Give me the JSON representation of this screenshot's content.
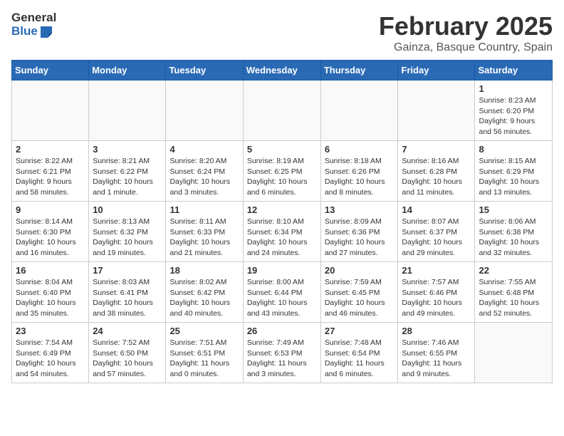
{
  "logo": {
    "general": "General",
    "blue": "Blue"
  },
  "title": "February 2025",
  "subtitle": "Gainza, Basque Country, Spain",
  "weekdays": [
    "Sunday",
    "Monday",
    "Tuesday",
    "Wednesday",
    "Thursday",
    "Friday",
    "Saturday"
  ],
  "weeks": [
    [
      {
        "day": "",
        "info": ""
      },
      {
        "day": "",
        "info": ""
      },
      {
        "day": "",
        "info": ""
      },
      {
        "day": "",
        "info": ""
      },
      {
        "day": "",
        "info": ""
      },
      {
        "day": "",
        "info": ""
      },
      {
        "day": "1",
        "info": "Sunrise: 8:23 AM\nSunset: 6:20 PM\nDaylight: 9 hours and 56 minutes."
      }
    ],
    [
      {
        "day": "2",
        "info": "Sunrise: 8:22 AM\nSunset: 6:21 PM\nDaylight: 9 hours and 58 minutes."
      },
      {
        "day": "3",
        "info": "Sunrise: 8:21 AM\nSunset: 6:22 PM\nDaylight: 10 hours and 1 minute."
      },
      {
        "day": "4",
        "info": "Sunrise: 8:20 AM\nSunset: 6:24 PM\nDaylight: 10 hours and 3 minutes."
      },
      {
        "day": "5",
        "info": "Sunrise: 8:19 AM\nSunset: 6:25 PM\nDaylight: 10 hours and 6 minutes."
      },
      {
        "day": "6",
        "info": "Sunrise: 8:18 AM\nSunset: 6:26 PM\nDaylight: 10 hours and 8 minutes."
      },
      {
        "day": "7",
        "info": "Sunrise: 8:16 AM\nSunset: 6:28 PM\nDaylight: 10 hours and 11 minutes."
      },
      {
        "day": "8",
        "info": "Sunrise: 8:15 AM\nSunset: 6:29 PM\nDaylight: 10 hours and 13 minutes."
      }
    ],
    [
      {
        "day": "9",
        "info": "Sunrise: 8:14 AM\nSunset: 6:30 PM\nDaylight: 10 hours and 16 minutes."
      },
      {
        "day": "10",
        "info": "Sunrise: 8:13 AM\nSunset: 6:32 PM\nDaylight: 10 hours and 19 minutes."
      },
      {
        "day": "11",
        "info": "Sunrise: 8:11 AM\nSunset: 6:33 PM\nDaylight: 10 hours and 21 minutes."
      },
      {
        "day": "12",
        "info": "Sunrise: 8:10 AM\nSunset: 6:34 PM\nDaylight: 10 hours and 24 minutes."
      },
      {
        "day": "13",
        "info": "Sunrise: 8:09 AM\nSunset: 6:36 PM\nDaylight: 10 hours and 27 minutes."
      },
      {
        "day": "14",
        "info": "Sunrise: 8:07 AM\nSunset: 6:37 PM\nDaylight: 10 hours and 29 minutes."
      },
      {
        "day": "15",
        "info": "Sunrise: 8:06 AM\nSunset: 6:38 PM\nDaylight: 10 hours and 32 minutes."
      }
    ],
    [
      {
        "day": "16",
        "info": "Sunrise: 8:04 AM\nSunset: 6:40 PM\nDaylight: 10 hours and 35 minutes."
      },
      {
        "day": "17",
        "info": "Sunrise: 8:03 AM\nSunset: 6:41 PM\nDaylight: 10 hours and 38 minutes."
      },
      {
        "day": "18",
        "info": "Sunrise: 8:02 AM\nSunset: 6:42 PM\nDaylight: 10 hours and 40 minutes."
      },
      {
        "day": "19",
        "info": "Sunrise: 8:00 AM\nSunset: 6:44 PM\nDaylight: 10 hours and 43 minutes."
      },
      {
        "day": "20",
        "info": "Sunrise: 7:59 AM\nSunset: 6:45 PM\nDaylight: 10 hours and 46 minutes."
      },
      {
        "day": "21",
        "info": "Sunrise: 7:57 AM\nSunset: 6:46 PM\nDaylight: 10 hours and 49 minutes."
      },
      {
        "day": "22",
        "info": "Sunrise: 7:55 AM\nSunset: 6:48 PM\nDaylight: 10 hours and 52 minutes."
      }
    ],
    [
      {
        "day": "23",
        "info": "Sunrise: 7:54 AM\nSunset: 6:49 PM\nDaylight: 10 hours and 54 minutes."
      },
      {
        "day": "24",
        "info": "Sunrise: 7:52 AM\nSunset: 6:50 PM\nDaylight: 10 hours and 57 minutes."
      },
      {
        "day": "25",
        "info": "Sunrise: 7:51 AM\nSunset: 6:51 PM\nDaylight: 11 hours and 0 minutes."
      },
      {
        "day": "26",
        "info": "Sunrise: 7:49 AM\nSunset: 6:53 PM\nDaylight: 11 hours and 3 minutes."
      },
      {
        "day": "27",
        "info": "Sunrise: 7:48 AM\nSunset: 6:54 PM\nDaylight: 11 hours and 6 minutes."
      },
      {
        "day": "28",
        "info": "Sunrise: 7:46 AM\nSunset: 6:55 PM\nDaylight: 11 hours and 9 minutes."
      },
      {
        "day": "",
        "info": ""
      }
    ]
  ]
}
